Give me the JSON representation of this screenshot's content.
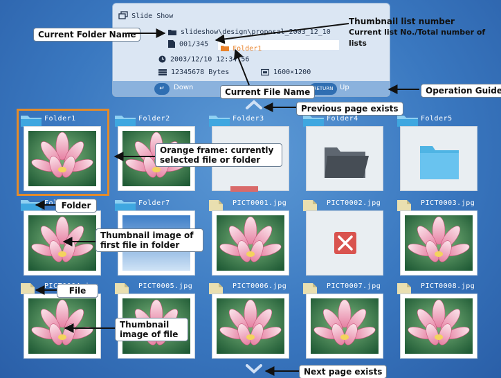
{
  "info_panel": {
    "title": "Slide Show",
    "folder_path": "slideshow\\design\\proposal_2003_12_10",
    "file_counter": "001/345",
    "current_file": "Folder1",
    "datetime": "2003/12/10 12:34:56",
    "file_size": "12345678 Bytes",
    "resolution": "1600×1200",
    "guide_down_label": "Down",
    "guide_return_key": "RETURN",
    "guide_up_label": "Up"
  },
  "grid": {
    "rows": [
      [
        {
          "label": "Folder1",
          "kind": "folder",
          "content": "photo"
        },
        {
          "label": "Folder2",
          "kind": "folder",
          "content": "photo"
        },
        {
          "label": "Folder3",
          "kind": "folder",
          "content": "empty"
        },
        {
          "label": "Folder4",
          "kind": "folder",
          "content": "folder-dark-icon"
        },
        {
          "label": "Folder5",
          "kind": "folder",
          "content": "folder-light-icon"
        }
      ],
      [
        {
          "label": "Folder6",
          "kind": "folder",
          "content": "photo"
        },
        {
          "label": "Folder7",
          "kind": "folder",
          "content": "sky"
        },
        {
          "label": "PICT0001.jpg",
          "kind": "file",
          "content": "photo"
        },
        {
          "label": "PICT0002.jpg",
          "kind": "file",
          "content": "error-x-icon"
        },
        {
          "label": "PICT0003.jpg",
          "kind": "file",
          "content": "photo"
        }
      ],
      [
        {
          "label": "PICT0004.jpg",
          "kind": "file",
          "content": "photo"
        },
        {
          "label": "PICT0005.jpg",
          "kind": "file",
          "content": "photo"
        },
        {
          "label": "PICT0006.jpg",
          "kind": "file",
          "content": "photo"
        },
        {
          "label": "PICT0007.jpg",
          "kind": "file",
          "content": "photo"
        },
        {
          "label": "PICT0008.jpg",
          "kind": "file",
          "content": "photo"
        }
      ]
    ],
    "selected": "Folder1"
  },
  "callouts": {
    "current_folder_name": "Current Folder Name",
    "thumb_list_number_1": "Thumbnail list number",
    "thumb_list_number_2": "Current list No./Total number of lists",
    "current_file_name": "Current File Name",
    "operation_guide": "Operation Guide",
    "previous_page": "Previous page exists",
    "orange_frame_1": "Orange frame: currently",
    "orange_frame_2": "selected file or folder",
    "folder": "Folder",
    "thumb_first_1": "Thumbnail image of",
    "thumb_first_2": "first file in folder",
    "file": "File",
    "thumb_file_1": "Thumbnail",
    "thumb_file_2": "image of file",
    "next_page": "Next page exists"
  },
  "colors": {
    "background": "#3a78c0",
    "selection": "#e38b2b",
    "folder_tab": "#3fa7e0",
    "file_tab": "#e9dfb0",
    "error": "#d9534f"
  }
}
